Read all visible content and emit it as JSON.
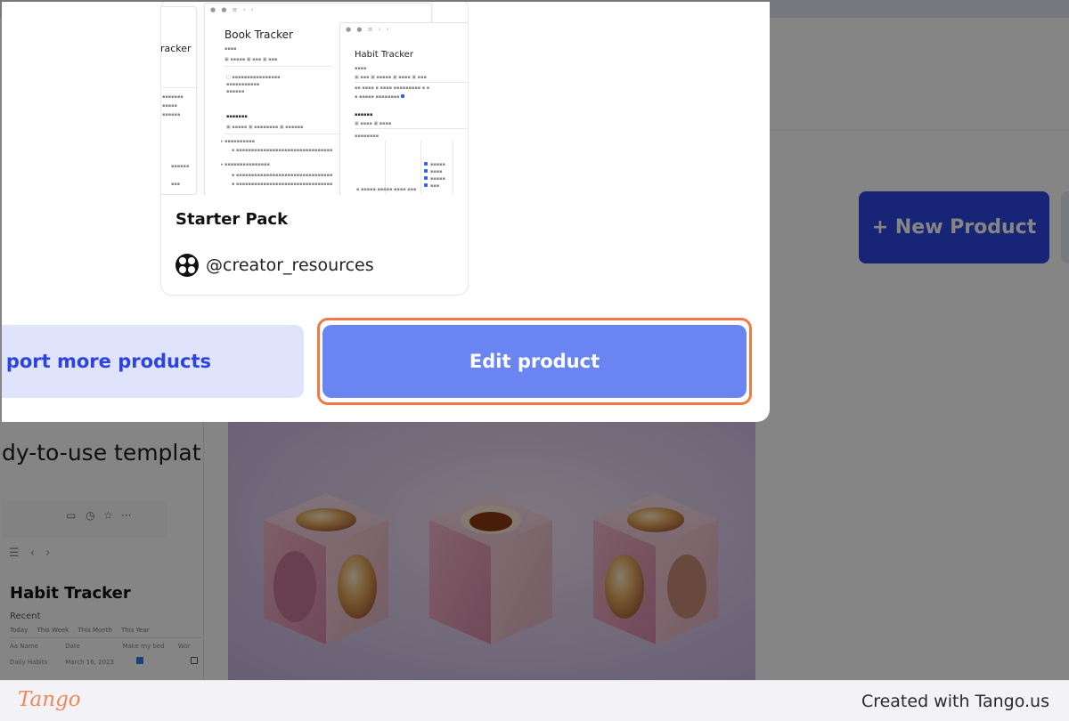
{
  "background": {
    "new_product_label": "+ New Product",
    "headline": "dy-to-use templat",
    "habit_preview": {
      "title": "Habit Tracker",
      "section": "Recent",
      "tabs": [
        "Today",
        "This Week",
        "This Month",
        "This Year"
      ],
      "columns": [
        "Aa Name",
        "Date",
        "Make my bed",
        "Wor"
      ],
      "row": {
        "name": "Daily Habits",
        "date": "March 16, 2023"
      }
    }
  },
  "modal": {
    "product": {
      "thumb_doc1_title": "Book Tracker",
      "thumb_doc2_title": "Habit Tracker",
      "thumb_left_title": "racker",
      "title": "Starter Pack",
      "creator": "@creator_resources"
    },
    "import_label": "port more products",
    "edit_label": "Edit product"
  },
  "footer": {
    "logo": "Tango",
    "credit": "Created with Tango.us"
  },
  "colors": {
    "accent": "#2f46e3",
    "edit_button": "#6a84f2",
    "import_button_bg": "#dfe3fb",
    "focus_ring": "#f07a45",
    "tango_brand": "#f0885a"
  },
  "icons": [
    "comment-icon",
    "clock-icon",
    "star-icon",
    "more-icon",
    "menu-icon",
    "back-icon",
    "forward-icon",
    "creator-logo-icon"
  ]
}
